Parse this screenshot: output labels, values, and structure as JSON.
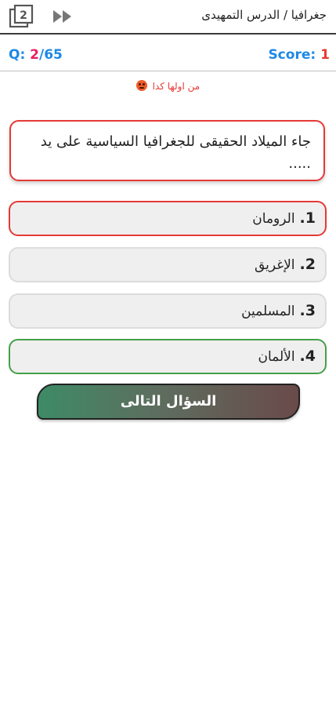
{
  "header": {
    "title": "جغرافيا / الدرس التمهيدى",
    "icons": [
      "pages-icon",
      "skip-forward-icon"
    ]
  },
  "stats": {
    "q_prefix": "Q:",
    "q_current": "2",
    "q_total": "/65",
    "score_label": "Score:",
    "score_value": "1"
  },
  "feedback": {
    "text": "من اولها كدا",
    "icon": "angry-face-icon"
  },
  "question": {
    "text": "جاء الميلاد الحقيقى للجغرافيا السياسية على يد ....."
  },
  "options": [
    {
      "num": "1.",
      "label": "الرومان",
      "state": "wrong"
    },
    {
      "num": "2.",
      "label": "الإغريق",
      "state": "normal"
    },
    {
      "num": "3.",
      "label": "المسلمين",
      "state": "normal"
    },
    {
      "num": "4.",
      "label": "الألمان",
      "state": "correct"
    }
  ],
  "next_button": {
    "label": "السؤال التالى"
  },
  "colors": {
    "accent_blue": "#1e88e5",
    "wrong_red": "#e53935",
    "correct_green": "#43a047",
    "current_pink": "#e91e63"
  }
}
